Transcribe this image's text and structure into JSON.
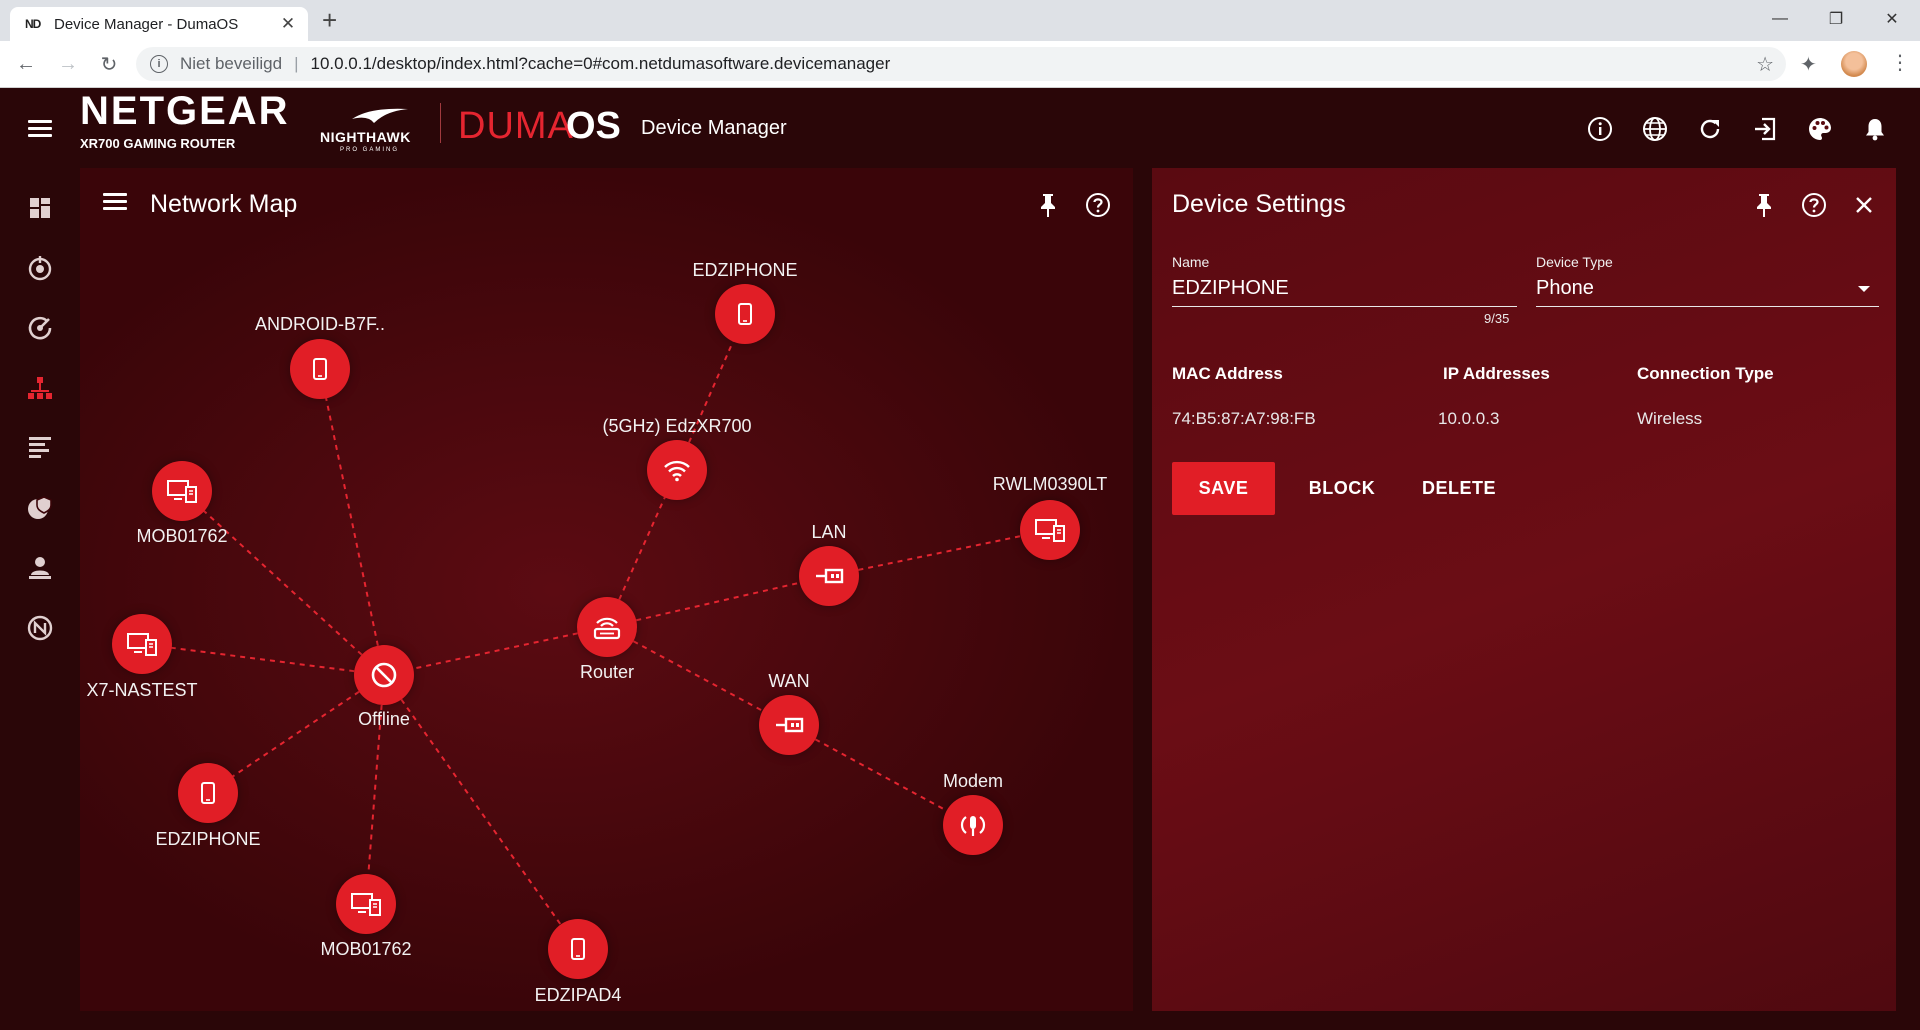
{
  "browser": {
    "tab_title": "Device Manager - DumaOS",
    "tab_favicon": "ND",
    "security_label": "Niet beveiligd",
    "url": "10.0.0.1/desktop/index.html?cache=0#com.netdumasoftware.devicemanager"
  },
  "header": {
    "brand": "NETGEAR",
    "model": "XR700 GAMING ROUTER",
    "nighthawk": "NIGHTHAWK",
    "nighthawk_sub": "PRO GAMING",
    "duma": "DUMA",
    "os": "OS",
    "app_title": "Device Manager",
    "icons": [
      "info-icon",
      "globe-icon",
      "refresh-icon",
      "logout-icon",
      "palette-icon",
      "bell-icon"
    ]
  },
  "leftnav": {
    "icons": [
      "dashboard-icon",
      "geo-filter-icon",
      "qos-icon",
      "device-manager-icon",
      "network-monitor-icon",
      "security-icon",
      "ping-heatmap-icon",
      "duma-logo-icon"
    ]
  },
  "map": {
    "title": "Network Map",
    "nodes": [
      {
        "id": "edziphone-top",
        "label": "EDZIPHONE",
        "type": "phone"
      },
      {
        "id": "android",
        "label": "ANDROID-B7F..",
        "type": "phone"
      },
      {
        "id": "ap5ghz",
        "label": "(5GHz) EdzXR700",
        "type": "wifi"
      },
      {
        "id": "mob-top",
        "label": "MOB01762",
        "type": "computer"
      },
      {
        "id": "rwlm",
        "label": "RWLM0390LT",
        "type": "computer"
      },
      {
        "id": "lan",
        "label": "LAN",
        "type": "ethernet"
      },
      {
        "id": "router",
        "label": "Router",
        "type": "router"
      },
      {
        "id": "x7",
        "label": "X7-NASTEST",
        "type": "computer"
      },
      {
        "id": "offline",
        "label": "Offline",
        "type": "offline"
      },
      {
        "id": "wan",
        "label": "WAN",
        "type": "ethernet"
      },
      {
        "id": "modem",
        "label": "Modem",
        "type": "modem"
      },
      {
        "id": "edziphone-bottom",
        "label": "EDZIPHONE",
        "type": "phone"
      },
      {
        "id": "mob-bottom",
        "label": "MOB01762",
        "type": "computer"
      },
      {
        "id": "edzipad4",
        "label": "EDZIPAD4",
        "type": "phone"
      }
    ]
  },
  "settings": {
    "title": "Device Settings",
    "name_label": "Name",
    "name_value": "EDZIPHONE",
    "name_counter": "9/35",
    "type_label": "Device Type",
    "type_value": "Phone",
    "mac_label": "MAC Address",
    "mac_value": "74:B5:87:A7:98:FB",
    "ip_label": "IP Addresses",
    "ip_value": "10.0.0.3",
    "conn_label": "Connection Type",
    "conn_value": "Wireless",
    "save": "SAVE",
    "block": "BLOCK",
    "delete": "DELETE"
  },
  "colors": {
    "accent": "#e11e26",
    "background": "#2a0608"
  }
}
